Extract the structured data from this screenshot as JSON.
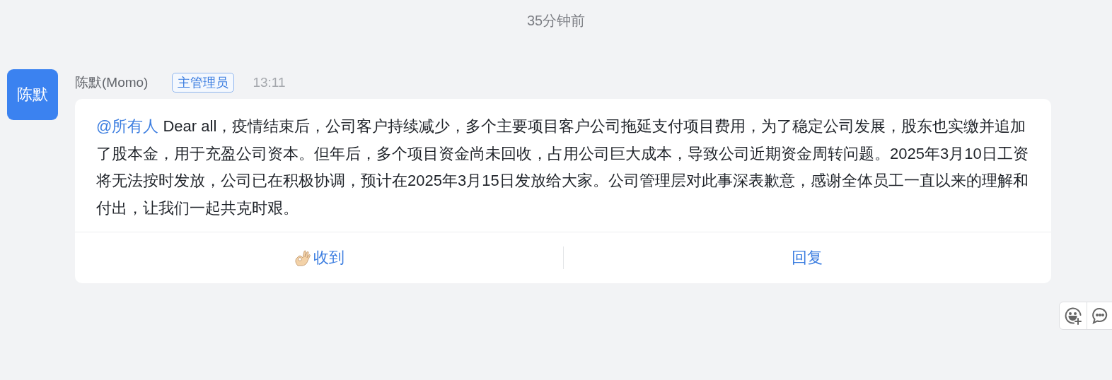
{
  "time_divider": "35分钟前",
  "message": {
    "avatar": "陈默",
    "sender": "陈默(Momo)",
    "role_badge": "主管理员",
    "time": "13:11",
    "mention": "@所有人",
    "text": " Dear all，疫情结束后，公司客户持续减少，多个主要项目客户公司拖延支付项目费用，为了稳定公司发展，股东也实缴并追加了股本金，用于充盈公司资本。但年后，多个项目资金尚未回收，占用公司巨大成本，导致公司近期资金周转问题。2025年3月10日工资将无法按时发放，公司已在积极协调，预计在2025年3月15日发放给大家。公司管理层对此事深表歉意，感谢全体员工一直以来的理解和付出，让我们一起共克时艰。",
    "actions": [
      {
        "kind": "ack",
        "label": "收到"
      },
      {
        "kind": "reply",
        "label": "回复"
      }
    ]
  }
}
